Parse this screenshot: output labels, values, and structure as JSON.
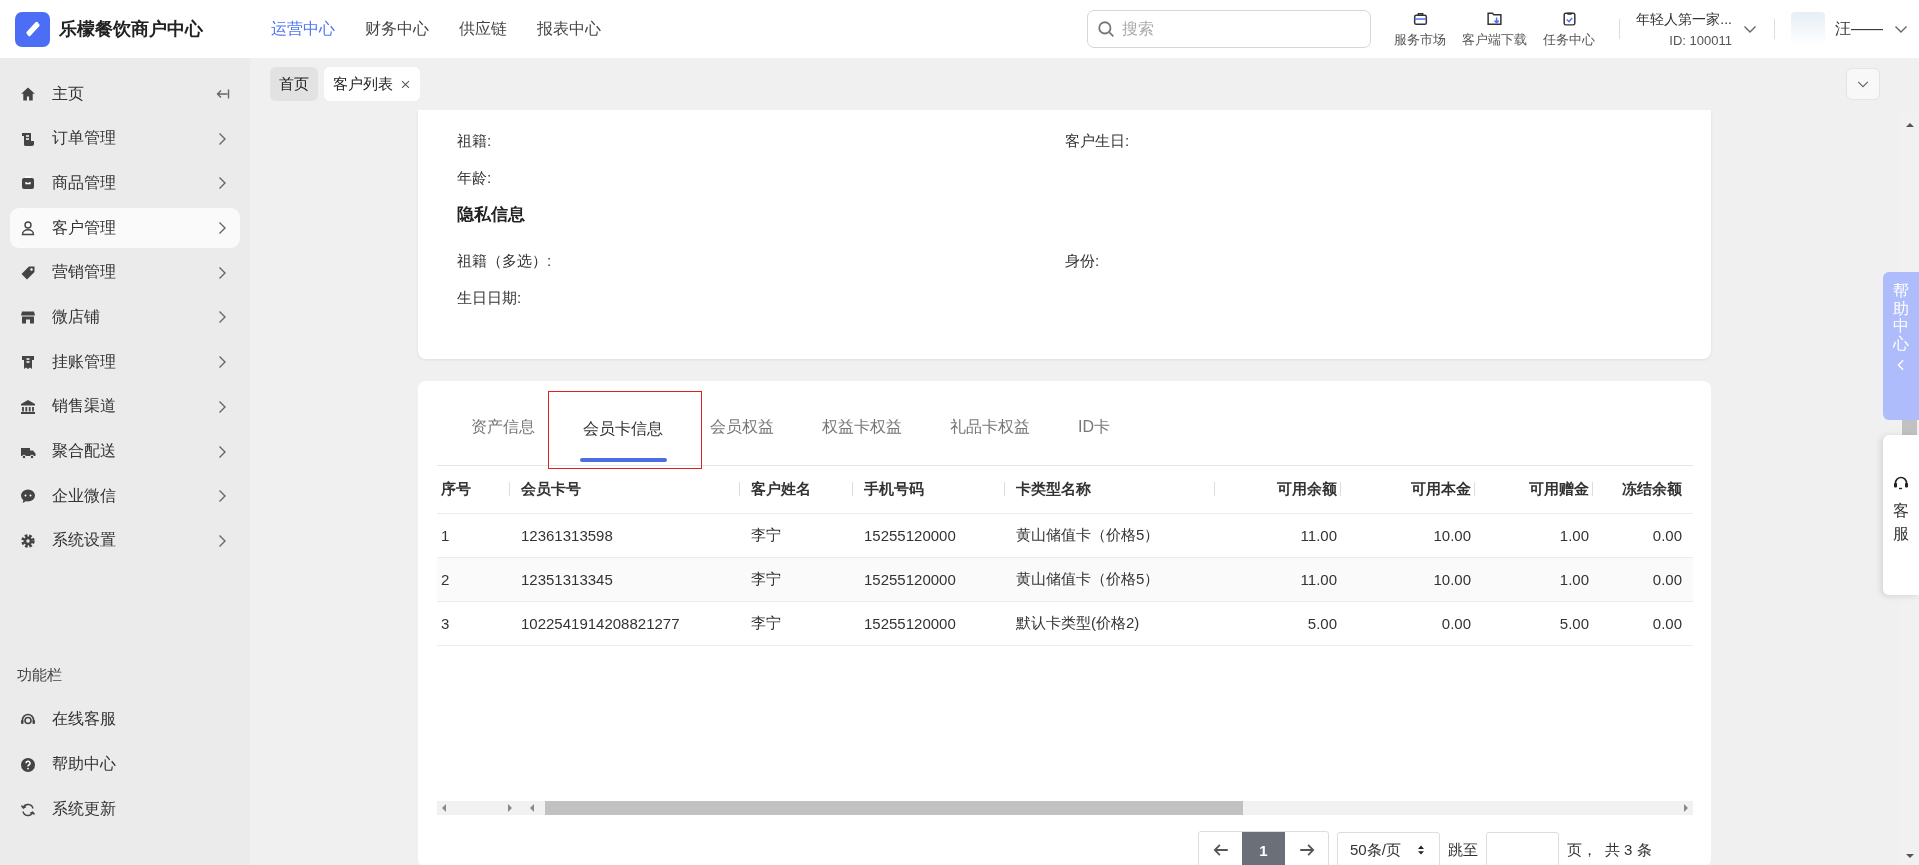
{
  "brand": {
    "name": "乐檬餐饮商户中心"
  },
  "top_nav": [
    {
      "label": "运营中心",
      "selected": true
    },
    {
      "label": "财务中心",
      "selected": false
    },
    {
      "label": "供应链",
      "selected": false
    },
    {
      "label": "报表中心",
      "selected": false
    }
  ],
  "search": {
    "placeholder": "搜索"
  },
  "toolbar": [
    {
      "label": "服务市场"
    },
    {
      "label": "客户端下载"
    },
    {
      "label": "任务中心"
    }
  ],
  "account": {
    "name": "年轻人第一家...",
    "id": "ID: 100011"
  },
  "user": {
    "name": "汪——"
  },
  "sidebar": {
    "items": [
      {
        "label": "主页",
        "selected": false
      },
      {
        "label": "订单管理",
        "selected": false
      },
      {
        "label": "商品管理",
        "selected": false
      },
      {
        "label": "客户管理",
        "selected": true
      },
      {
        "label": "营销管理",
        "selected": false
      },
      {
        "label": "微店铺",
        "selected": false
      },
      {
        "label": "挂账管理",
        "selected": false
      },
      {
        "label": "销售渠道",
        "selected": false
      },
      {
        "label": "聚合配送",
        "selected": false
      },
      {
        "label": "企业微信",
        "selected": false
      },
      {
        "label": "系统设置",
        "selected": false
      }
    ],
    "section_title": "功能栏",
    "tools": [
      {
        "label": "在线客服"
      },
      {
        "label": "帮助中心"
      },
      {
        "label": "系统更新"
      }
    ]
  },
  "page_tabs": [
    {
      "label": "首页",
      "selected": false,
      "closable": false
    },
    {
      "label": "客户列表",
      "selected": true,
      "closable": true
    }
  ],
  "profile": {
    "fields": [
      {
        "label": "祖籍:"
      },
      {
        "label": "客户生日:"
      },
      {
        "label": "年龄:"
      }
    ],
    "privacy": {
      "title": "隐私信息",
      "fields": [
        {
          "label": "祖籍（多选）:"
        },
        {
          "label": "身份:"
        },
        {
          "label": "生日日期:"
        }
      ]
    }
  },
  "detail_tabs": [
    {
      "label": "资产信息",
      "selected": false,
      "highlighted": false
    },
    {
      "label": "会员卡信息",
      "selected": true,
      "highlighted": true
    },
    {
      "label": "会员权益",
      "selected": false,
      "highlighted": false
    },
    {
      "label": "权益卡权益",
      "selected": false,
      "highlighted": false
    },
    {
      "label": "礼品卡权益",
      "selected": false,
      "highlighted": false
    },
    {
      "label": "ID卡",
      "selected": false,
      "highlighted": false
    }
  ],
  "table": {
    "columns": [
      {
        "label": "序号",
        "kind": "text"
      },
      {
        "label": "会员卡号",
        "kind": "text"
      },
      {
        "label": "客户姓名",
        "kind": "text"
      },
      {
        "label": "手机号码",
        "kind": "text"
      },
      {
        "label": "卡类型名称",
        "kind": "text"
      },
      {
        "label": "可用余额",
        "kind": "amount"
      },
      {
        "label": "可用本金",
        "kind": "amount"
      },
      {
        "label": "可用赠金",
        "kind": "amount"
      },
      {
        "label": "冻结余额",
        "kind": "amount"
      }
    ],
    "rows": [
      [
        "1",
        "12361313598",
        "李宁",
        "15255120000",
        "黄山储值卡（价格5）",
        "11.00",
        "10.00",
        "1.00",
        "0.00"
      ],
      [
        "2",
        "12351313345",
        "李宁",
        "15255120000",
        "黄山储值卡（价格5）",
        "11.00",
        "10.00",
        "1.00",
        "0.00"
      ],
      [
        "3",
        "1022541914208821277",
        "李宁",
        "15255120000",
        "默认卡类型(价格2)",
        "5.00",
        "0.00",
        "5.00",
        "0.00"
      ]
    ]
  },
  "pagination": {
    "pages": [
      {
        "label": "1",
        "selected": true
      }
    ],
    "page_size": "50条/页",
    "jump_label": "跳至",
    "page_suffix": "页，",
    "total": "共 3 条"
  },
  "help_panel": {
    "label": "帮助中心"
  },
  "service": {
    "label": "客服"
  }
}
